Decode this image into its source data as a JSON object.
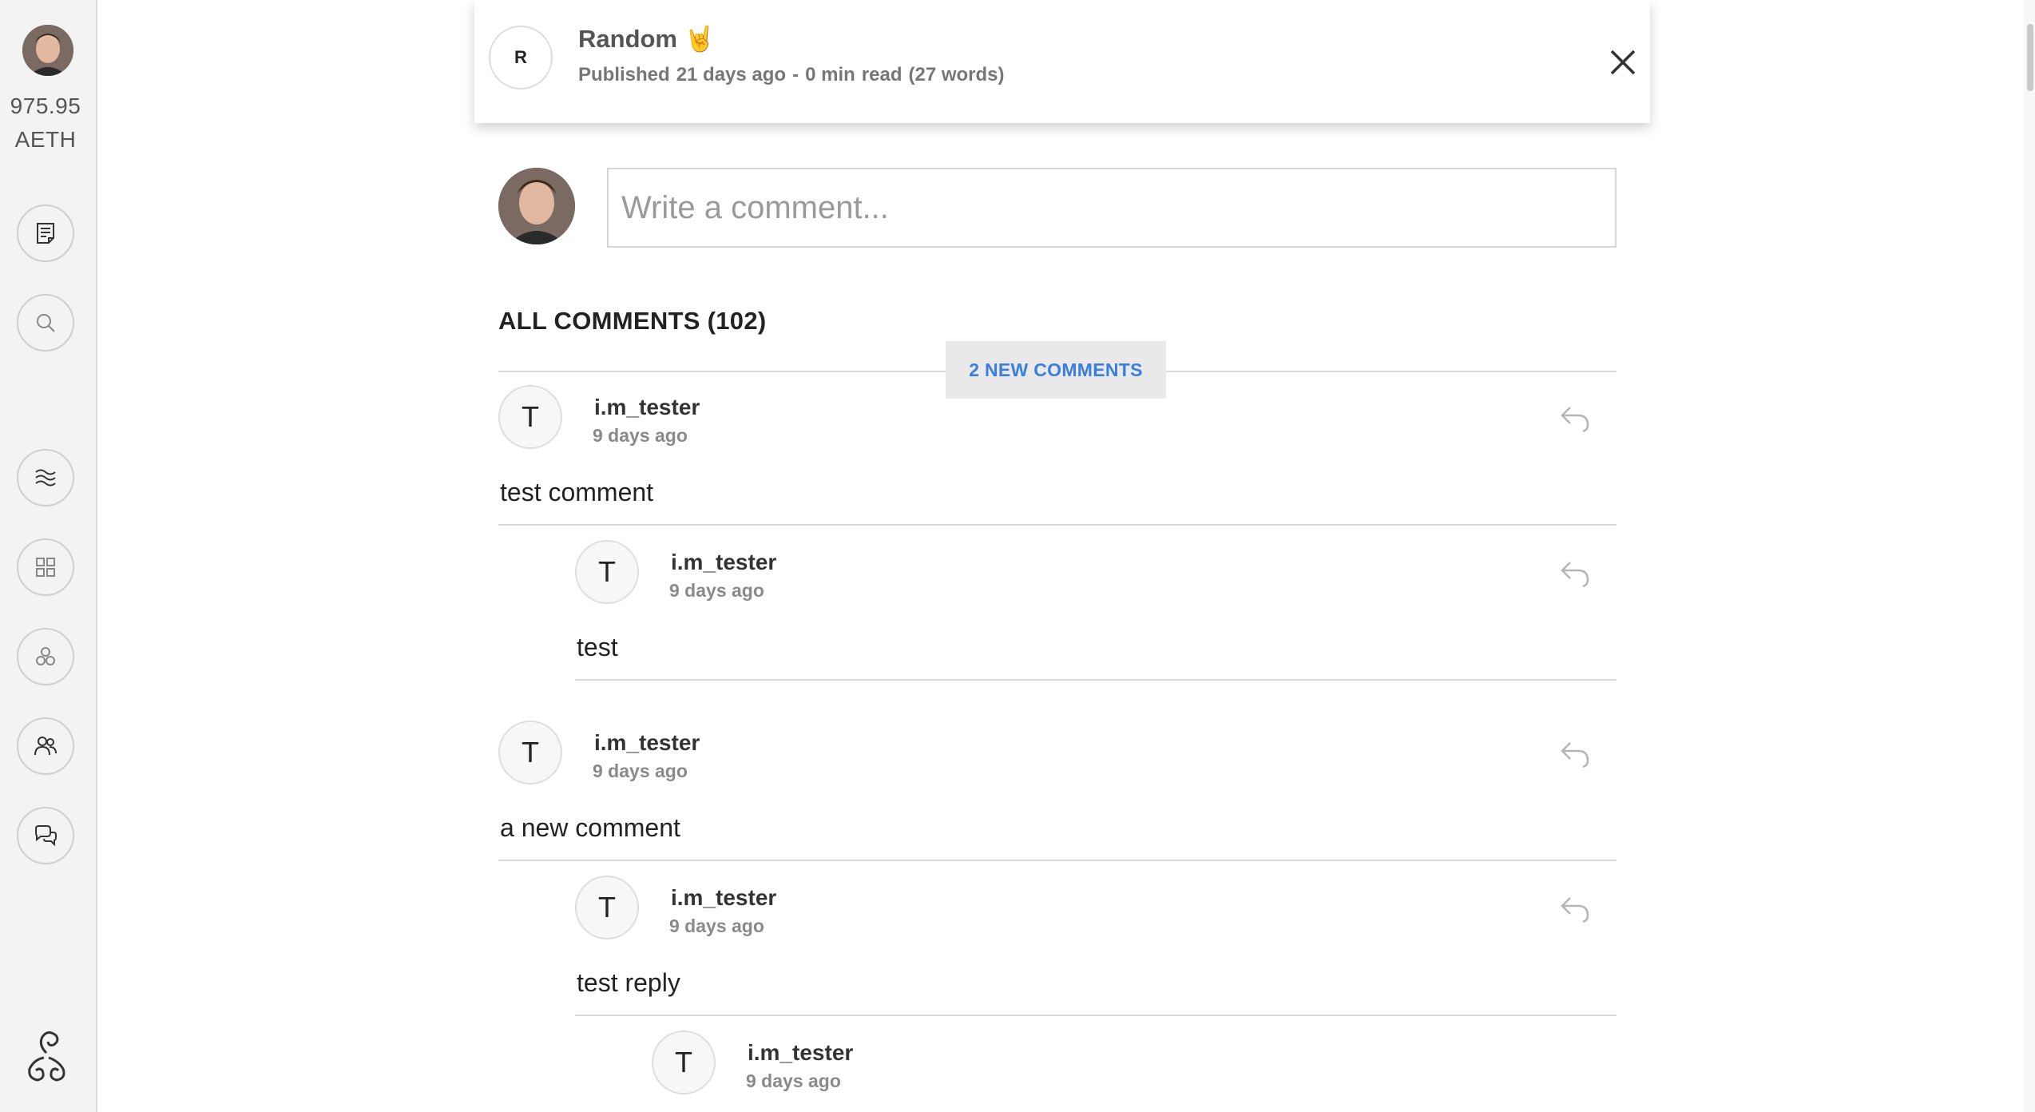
{
  "sidebar": {
    "balance_amount": "975.95",
    "balance_unit": "AETH",
    "nav_icons": [
      "posts-icon",
      "search-icon",
      "streams-icon",
      "apps-grid-icon",
      "communities-icon",
      "people-icon",
      "chat-icon"
    ],
    "logo_icon": "triskelion-logo-icon"
  },
  "post_header": {
    "initial": "R",
    "title": "Random 🤘",
    "published_label": "Published",
    "published_time": "21 days ago",
    "separator": "-",
    "read_time": "0 min",
    "read_label": "read",
    "word_count": "(27 words)",
    "close_icon": "close-icon"
  },
  "comment_composer": {
    "placeholder": "Write a comment..."
  },
  "comments_section": {
    "heading": "ALL COMMENTS (102)",
    "new_comments_button": "2 NEW COMMENTS",
    "comments": [
      {
        "initial": "T",
        "user": "i.m_tester",
        "time": "9 days ago",
        "text": "test comment",
        "depth": 0
      },
      {
        "initial": "T",
        "user": "i.m_tester",
        "time": "9 days ago",
        "text": "test",
        "depth": 1
      },
      {
        "initial": "T",
        "user": "i.m_tester",
        "time": "9 days ago",
        "text": "a new comment",
        "depth": 0
      },
      {
        "initial": "T",
        "user": "i.m_tester",
        "time": "9 days ago",
        "text": "test reply",
        "depth": 1
      },
      {
        "initial": "T",
        "user": "i.m_tester",
        "time": "9 days ago",
        "text": "",
        "depth": 2
      }
    ]
  },
  "colors": {
    "accent_blue": "#3a7ee0",
    "sidebar_bg": "#f3f3f3",
    "muted_text": "#8a8a8a"
  }
}
